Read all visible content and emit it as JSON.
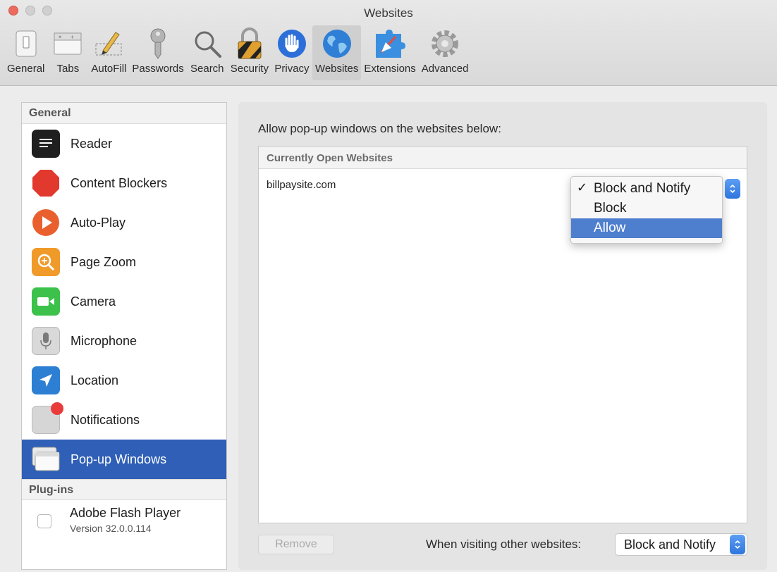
{
  "window": {
    "title": "Websites"
  },
  "toolbar": {
    "items": [
      {
        "label": "General",
        "icon": "general-switch-icon"
      },
      {
        "label": "Tabs",
        "icon": "tabs-icon"
      },
      {
        "label": "AutoFill",
        "icon": "autofill-pencil-icon"
      },
      {
        "label": "Passwords",
        "icon": "key-icon"
      },
      {
        "label": "Search",
        "icon": "magnifier-icon"
      },
      {
        "label": "Security",
        "icon": "padlock-icon"
      },
      {
        "label": "Privacy",
        "icon": "hand-icon"
      },
      {
        "label": "Websites",
        "icon": "globe-icon",
        "active": true
      },
      {
        "label": "Extensions",
        "icon": "puzzle-icon"
      },
      {
        "label": "Advanced",
        "icon": "gear-icon"
      }
    ]
  },
  "sidebar": {
    "general_header": "General",
    "items": [
      {
        "label": "Reader",
        "icon": "reader-icon"
      },
      {
        "label": "Content Blockers",
        "icon": "stop-sign-icon"
      },
      {
        "label": "Auto-Play",
        "icon": "play-icon"
      },
      {
        "label": "Page Zoom",
        "icon": "zoom-icon"
      },
      {
        "label": "Camera",
        "icon": "camera-icon"
      },
      {
        "label": "Microphone",
        "icon": "microphone-icon"
      },
      {
        "label": "Location",
        "icon": "location-arrow-icon"
      },
      {
        "label": "Notifications",
        "icon": "notifications-icon"
      },
      {
        "label": "Pop-up Windows",
        "icon": "popup-windows-icon",
        "selected": true
      }
    ],
    "plugins_header": "Plug-ins",
    "plugin": {
      "name": "Adobe Flash Player",
      "version": "Version 32.0.0.114",
      "enabled": false
    }
  },
  "main": {
    "heading": "Allow pop-up windows on the websites below:",
    "table_header": "Currently Open Websites",
    "site": "billpaysite.com",
    "popup_options": [
      {
        "label": "Block and Notify",
        "checked": true
      },
      {
        "label": "Block"
      },
      {
        "label": "Allow",
        "highlighted": true
      }
    ],
    "check_glyph": "✓",
    "remove_button": "Remove",
    "other_label": "When visiting other websites:",
    "other_value": "Block and Notify"
  },
  "colors": {
    "selection": "#2f5fb6",
    "menu_highlight": "#4e7fcf",
    "stepper": "#2f75de",
    "close_button": "#ed6a5e"
  }
}
